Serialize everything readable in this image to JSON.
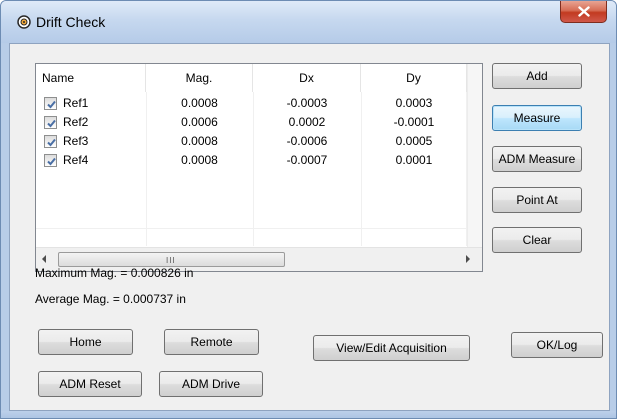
{
  "window": {
    "title": "Drift Check",
    "close_label": "x"
  },
  "table": {
    "columns": [
      "Name",
      "Mag.",
      "Dx",
      "Dy"
    ],
    "rows": [
      {
        "checked": true,
        "name": "Ref1",
        "mag": "0.0008",
        "dx": "-0.0003",
        "dy": "0.0003"
      },
      {
        "checked": true,
        "name": "Ref2",
        "mag": "0.0006",
        "dx": "0.0002",
        "dy": "-0.0001"
      },
      {
        "checked": true,
        "name": "Ref3",
        "mag": "0.0008",
        "dx": "-0.0006",
        "dy": "0.0005"
      },
      {
        "checked": true,
        "name": "Ref4",
        "mag": "0.0008",
        "dx": "-0.0007",
        "dy": "0.0001"
      }
    ],
    "scroll_grip": "III"
  },
  "side_buttons": {
    "add": "Add",
    "measure": "Measure",
    "adm_measure": "ADM Measure",
    "point_at": "Point At",
    "clear": "Clear"
  },
  "stats": {
    "max_mag": "Maximum Mag. = 0.000826 in",
    "avg_mag": "Average Mag. = 0.000737 in"
  },
  "bottom_buttons": {
    "home": "Home",
    "remote": "Remote",
    "view_edit": "View/Edit Acquisition",
    "ok_log": "OK/Log",
    "adm_reset": "ADM Reset",
    "adm_drive": "ADM Drive"
  },
  "icons": {
    "app": "target-icon",
    "close": "close-icon",
    "check": "checkmark-icon",
    "scroll_left": "arrow-left-icon",
    "scroll_right": "arrow-right-icon"
  },
  "colors": {
    "close_button": "#c74d37",
    "default_button_border": "#3c7fb1",
    "check_mark": "#4a6fa5"
  }
}
